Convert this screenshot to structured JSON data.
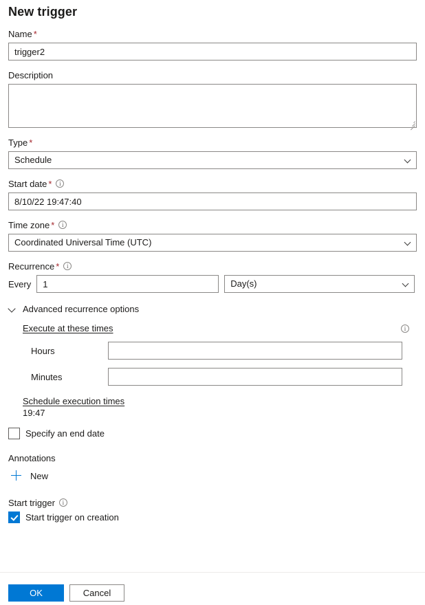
{
  "page": {
    "title": "New trigger"
  },
  "fields": {
    "name": {
      "label": "Name",
      "required_mark": "*",
      "value": "trigger2"
    },
    "description": {
      "label": "Description",
      "value": ""
    },
    "type": {
      "label": "Type",
      "required_mark": "*",
      "value": "Schedule"
    },
    "start_date": {
      "label": "Start date",
      "required_mark": "*",
      "value": "8/10/22 19:47:40"
    },
    "time_zone": {
      "label": "Time zone",
      "required_mark": "*",
      "value": "Coordinated Universal Time (UTC)"
    },
    "recurrence": {
      "label": "Recurrence",
      "required_mark": "*",
      "every_label": "Every",
      "interval_value": "1",
      "unit_value": "Day(s)"
    }
  },
  "advanced": {
    "toggle_label": "Advanced recurrence options",
    "execute_at_these_times": "Execute at these times",
    "hours_label": "Hours",
    "hours_value": "",
    "minutes_label": "Minutes",
    "minutes_value": "",
    "schedule_execution_times_label": "Schedule execution times",
    "schedule_execution_times_value": "19:47"
  },
  "end_date": {
    "checkbox_label": "Specify an end date",
    "checked": false
  },
  "annotations": {
    "label": "Annotations",
    "new_label": "New"
  },
  "start_trigger": {
    "label": "Start trigger",
    "checkbox_label": "Start trigger on creation",
    "checked": true
  },
  "footer": {
    "ok_label": "OK",
    "cancel_label": "Cancel"
  },
  "colors": {
    "accent": "#0078d4",
    "required": "#a4262c",
    "border": "#8a8886",
    "text": "#1b1a19"
  }
}
